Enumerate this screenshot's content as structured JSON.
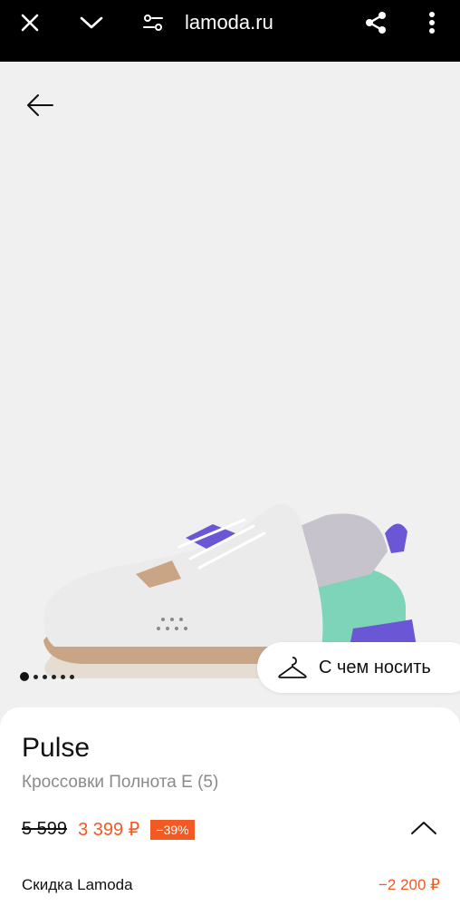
{
  "browser": {
    "url": "lamoda.ru",
    "icons": [
      "close-icon",
      "chevron-down-icon",
      "site-settings-icon",
      "share-icon",
      "more-vert-icon"
    ]
  },
  "product": {
    "gallery": {
      "slide_count": 6,
      "active_slide": 1
    },
    "wear_button_label": "С чем носить",
    "brand": "Pulse",
    "subtitle": "Кроссовки Полнота E (5)",
    "old_price": "5 599",
    "new_price": "3 399 ₽",
    "discount_badge": "−39%",
    "lamoda_discount_label": "Скидка Lamoda",
    "lamoda_discount_value": "−2 200 ₽"
  },
  "colors": {
    "accent": "#f15a22",
    "shoe_teal": "#7ed4b8",
    "shoe_purple": "#6b56d6",
    "shoe_tan": "#c9a585"
  }
}
